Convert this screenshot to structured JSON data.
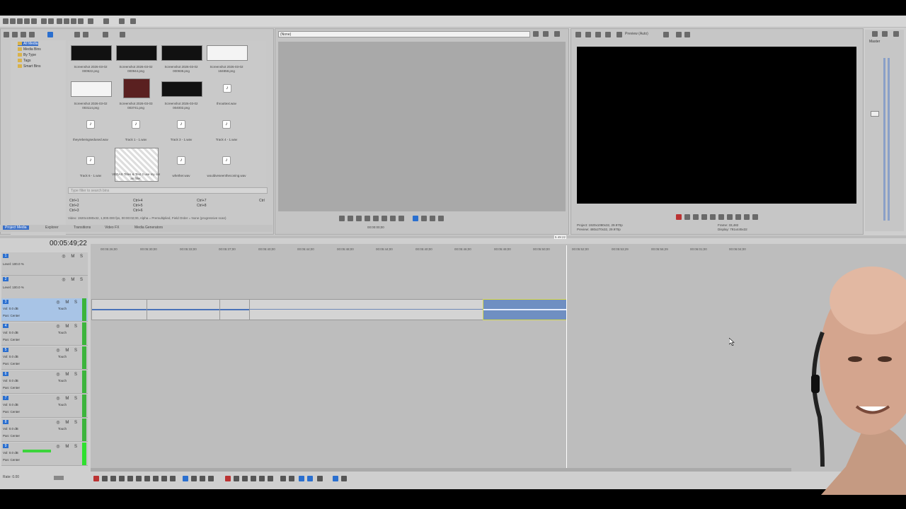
{
  "project_media": {
    "tree": [
      "All Media",
      "Media Bins",
      "By Type",
      "Tags",
      "Smart Bins"
    ],
    "items": [
      {
        "name": "Screenshot 2026-03-02 000922.png",
        "kind": "image-dark"
      },
      {
        "name": "Screenshot 2026-03-02 000944.png",
        "kind": "image-dark"
      },
      {
        "name": "Screenshot 2026-03-02 000938.png",
        "kind": "image-dark"
      },
      {
        "name": "Screenshot 2026-03-02 184858.png",
        "kind": "image-dark"
      },
      {
        "name": "Screenshot 2026-03-02 003114.png",
        "kind": "image-white"
      },
      {
        "name": "Screenshot 2026-03-03 003741.png",
        "kind": "image-red"
      },
      {
        "name": "Screenshot 2026-03-02 004002.png",
        "kind": "image-dark"
      },
      {
        "name": "throuttext.wav",
        "kind": "audio"
      },
      {
        "name": "theyrebeingsedused.wav",
        "kind": "audio"
      },
      {
        "name": "Track 1 - 1.wav",
        "kind": "audio"
      },
      {
        "name": "Track 3 - 1.wav",
        "kind": "audio"
      },
      {
        "name": "Track 4 - 1.wav",
        "kind": "audio"
      },
      {
        "name": "Track 6 - 1.wav",
        "kind": "audio"
      },
      {
        "name": "VEGAS Titles & Text 3 use my cat as filler.",
        "kind": "title"
      },
      {
        "name": "whether.wav",
        "kind": "audio"
      },
      {
        "name": "wouldveseentheconing.wav",
        "kind": "audio"
      }
    ],
    "search_placeholder": "Type filter to search bins",
    "shortcuts": [
      "Ctrl+1",
      "Ctrl+4",
      "Ctrl+7",
      "Ctrl",
      "Ctrl+2",
      "Ctrl+5",
      "Ctrl+8",
      "Ctrl+3",
      "Ctrl+6"
    ],
    "status_line": "Video: 1920x1080x32, 1,000.000 fps, 00:00:02;00, Alpha = Premultiplied, Field Order = None (progressive scan)"
  },
  "tabs": [
    "Project Media",
    "Explorer",
    "Transitions",
    "Video FX",
    "Media Generators"
  ],
  "trimmer": {
    "dropdown_value": "(None)",
    "time": "00:00:00;00"
  },
  "preview": {
    "mode_label": "Preview (Auto)",
    "project_line1": "Project: 1920x1080x32, 29.970p",
    "project_line2": "Preview: 480x270x32, 29.970p",
    "frame_line": "Frame: 33,482",
    "display_line": "Display: 791x445x32"
  },
  "master": {
    "label": "Master"
  },
  "timeline": {
    "current_time": "00:05:49;22",
    "ruler_ticks": [
      "00:05:26;00",
      "00:05:30;00",
      "00:05:33;00",
      "00:05:37;00",
      "00:05:40;00",
      "00:05:44;00",
      "00:05:48;00",
      "00:05:44;00",
      "00:05:40;00",
      "00:05:46;00",
      "00:05:49;00",
      "00:05:50;00",
      "00:05:52;00",
      "00:05:53;29",
      "00:05:56;29",
      "00:06:01;00",
      "00:06:04;00"
    ],
    "cursor_flag": "5:49:22",
    "tracks": [
      {
        "num": "1",
        "line1": "Level: 100.0 %",
        "line2": ""
      },
      {
        "num": "2",
        "line1": "Level: 100.0 %",
        "line2": ""
      },
      {
        "num": "3",
        "line1": "Vol: 0.0 dB",
        "line2": "Pan: Center"
      },
      {
        "num": "4",
        "line1": "Vol: 0.0 dB",
        "line2": "Pan: Center"
      },
      {
        "num": "5",
        "line1": "Vol: 0.0 dB",
        "line2": "Pan: Center"
      },
      {
        "num": "6",
        "line1": "Vol: 0.0 dB",
        "line2": "Pan: Center"
      },
      {
        "num": "7",
        "line1": "Vol: 0.0 dB",
        "line2": "Pan: Center"
      },
      {
        "num": "8",
        "line1": "Vol: 0.0 dB",
        "line2": "Pan: Center"
      },
      {
        "num": "9",
        "line1": "Vol: 0.0 dB",
        "line2": "Pan: Center"
      }
    ],
    "touch_label": "Touch",
    "rate_label": "Rate: 0.00"
  }
}
